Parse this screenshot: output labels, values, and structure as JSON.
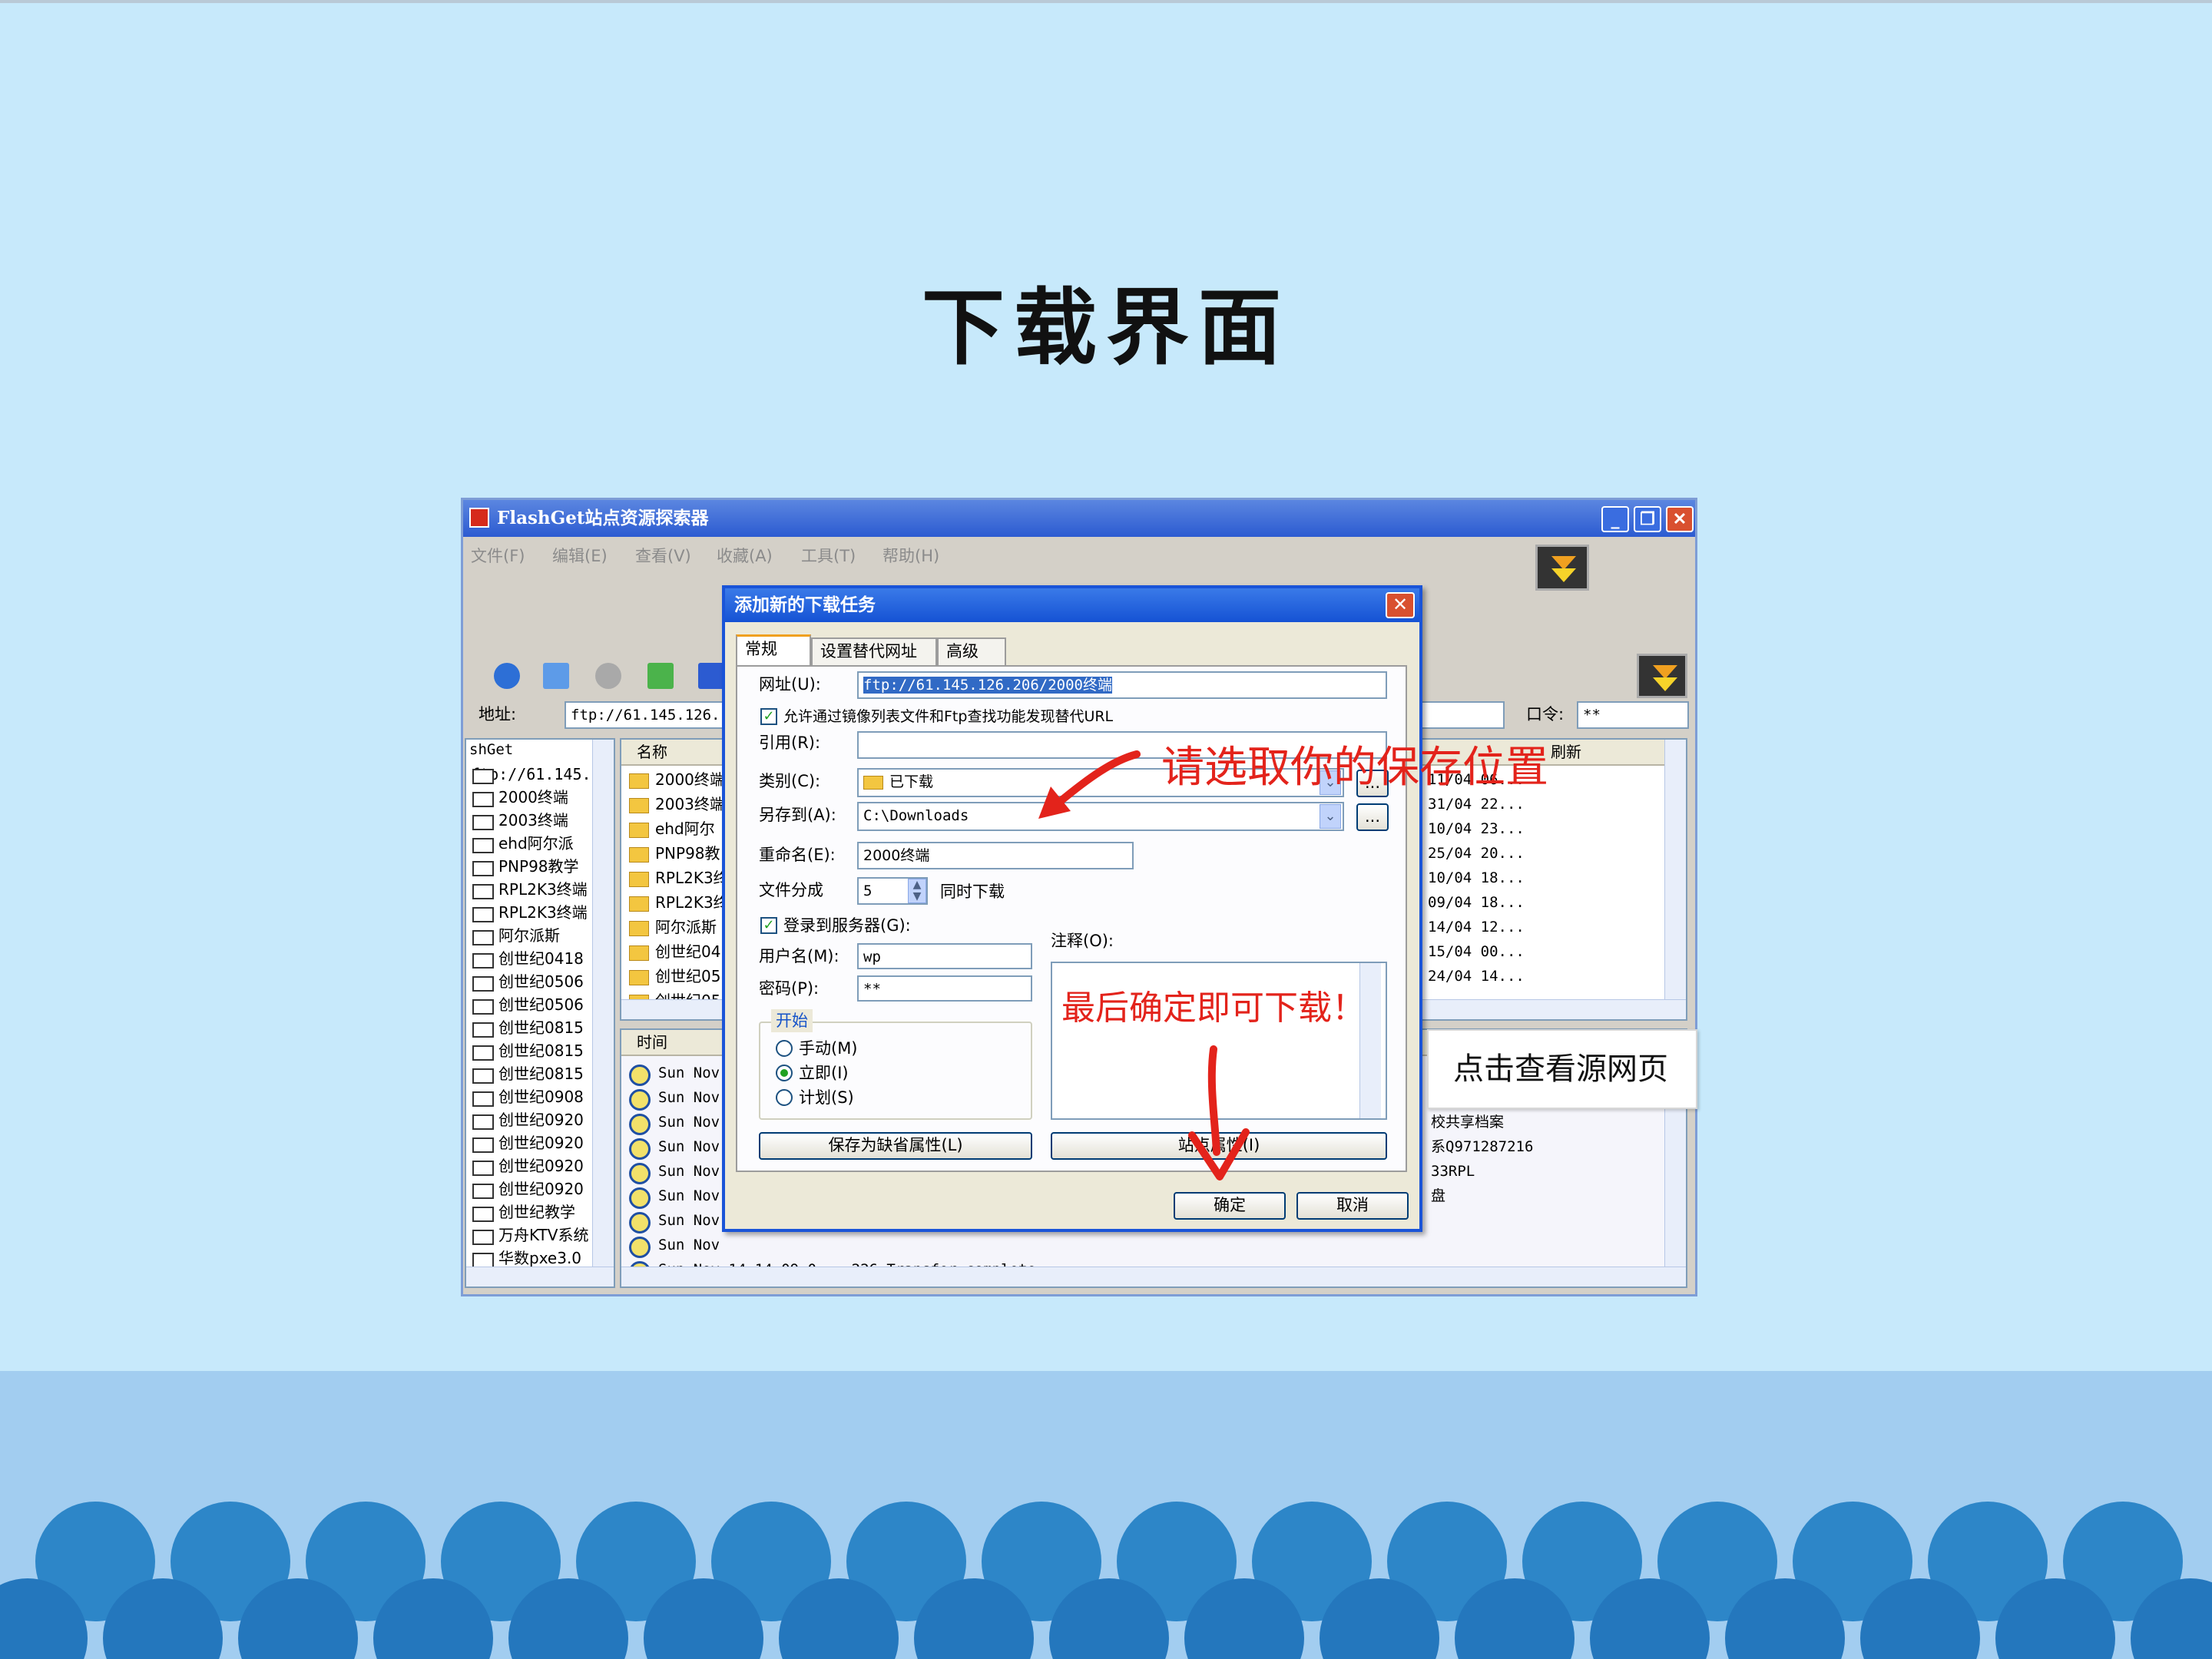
{
  "slide": {
    "title": "下载界面"
  },
  "window": {
    "title": "FlashGet站点资源探索器",
    "menu": [
      "文件(F)",
      "编辑(E)",
      "查看(V)",
      "收藏(A)",
      "工具(T)",
      "帮助(H)"
    ],
    "address_label": "地址:",
    "address_value": "ftp://61.145.126.",
    "password_label": "口令:",
    "password_value": "**",
    "tree_header": "shGet",
    "tree_items": [
      "ftp://61.145.",
      "2000终端",
      "2003终端",
      "ehd阿尔派",
      "PNP98教学",
      "RPL2K3终端",
      "RPL2K3终端",
      "阿尔派斯",
      "创世纪0418",
      "创世纪0506",
      "创世纪0506",
      "创世纪0815",
      "创世纪0815",
      "创世纪0815",
      "创世纪0908",
      "创世纪0920",
      "创世纪0920",
      "创世纪0920",
      "创世纪0920",
      "创世纪教学",
      "万舟KTV系统",
      "华数pxe3.0"
    ],
    "list_header": "名称",
    "list_items": [
      "2000终端",
      "2003终端",
      "ehd阿尔",
      "PNP98教",
      "RPL2K3终",
      "RPL2K3终",
      "阿尔派斯",
      "创世纪04",
      "创世纪05",
      "创世纪05"
    ],
    "right_header": "刷新",
    "right_dates": [
      "11/04 06...",
      "31/04 22...",
      "10/04 23...",
      "25/04 20...",
      "10/04 18...",
      "09/04 18...",
      "14/04 12...",
      "15/04 00...",
      "24/04 14..."
    ],
    "log_header": "时间",
    "log_items": [
      "Sun Nov",
      "Sun Nov",
      "Sun Nov",
      "Sun Nov",
      "Sun Nov",
      "Sun Nov",
      "Sun Nov",
      "Sun Nov"
    ],
    "log_last": "Sun Nov 14 14:09:0...  226 Transfer complete.",
    "log_right": [
      "校共享档案",
      "系Q971287216",
      "33RPL",
      "盘"
    ]
  },
  "dialog": {
    "title": "添加新的下载任务",
    "tabs": [
      "常规",
      "设置替代网址",
      "高级"
    ],
    "url_label": "网址(U):",
    "url_value": "ftp://61.145.126.206/2000终端",
    "mirror_check_label": "允许通过镜像列表文件和Ftp查找功能发现替代URL",
    "referer_label": "引用(R):",
    "category_label": "类别(C):",
    "category_value": "已下载",
    "saveto_label": "另存到(A):",
    "saveto_value": "C:\\Downloads",
    "rename_label": "重命名(E):",
    "rename_value": "2000终端",
    "split_label": "文件分成",
    "split_value": "5",
    "split_suffix": "同时下载",
    "login_label": "登录到服务器(G):",
    "user_label": "用户名(M):",
    "user_value": "wp",
    "pass_label": "密码(P):",
    "pass_value": "**",
    "comment_label": "注释(O):",
    "start_group": "开始",
    "start_options": [
      "手动(M)",
      "立即(I)",
      "计划(S)"
    ],
    "save_default_btn": "保存为缺省属性(L)",
    "site_prop_btn": "站点属性(I)",
    "ok_btn": "确定",
    "cancel_btn": "取消",
    "more_btn": "..."
  },
  "annotations": {
    "choose_location": "请选取你的保存位置",
    "confirm": "最后确定即可下载！"
  },
  "tooltip": "点击查看源网页",
  "colors": {
    "annotation": "#e3231b",
    "background": "#c7e9fb",
    "wave": "#2d86c8",
    "band": "#a2cdf0"
  }
}
